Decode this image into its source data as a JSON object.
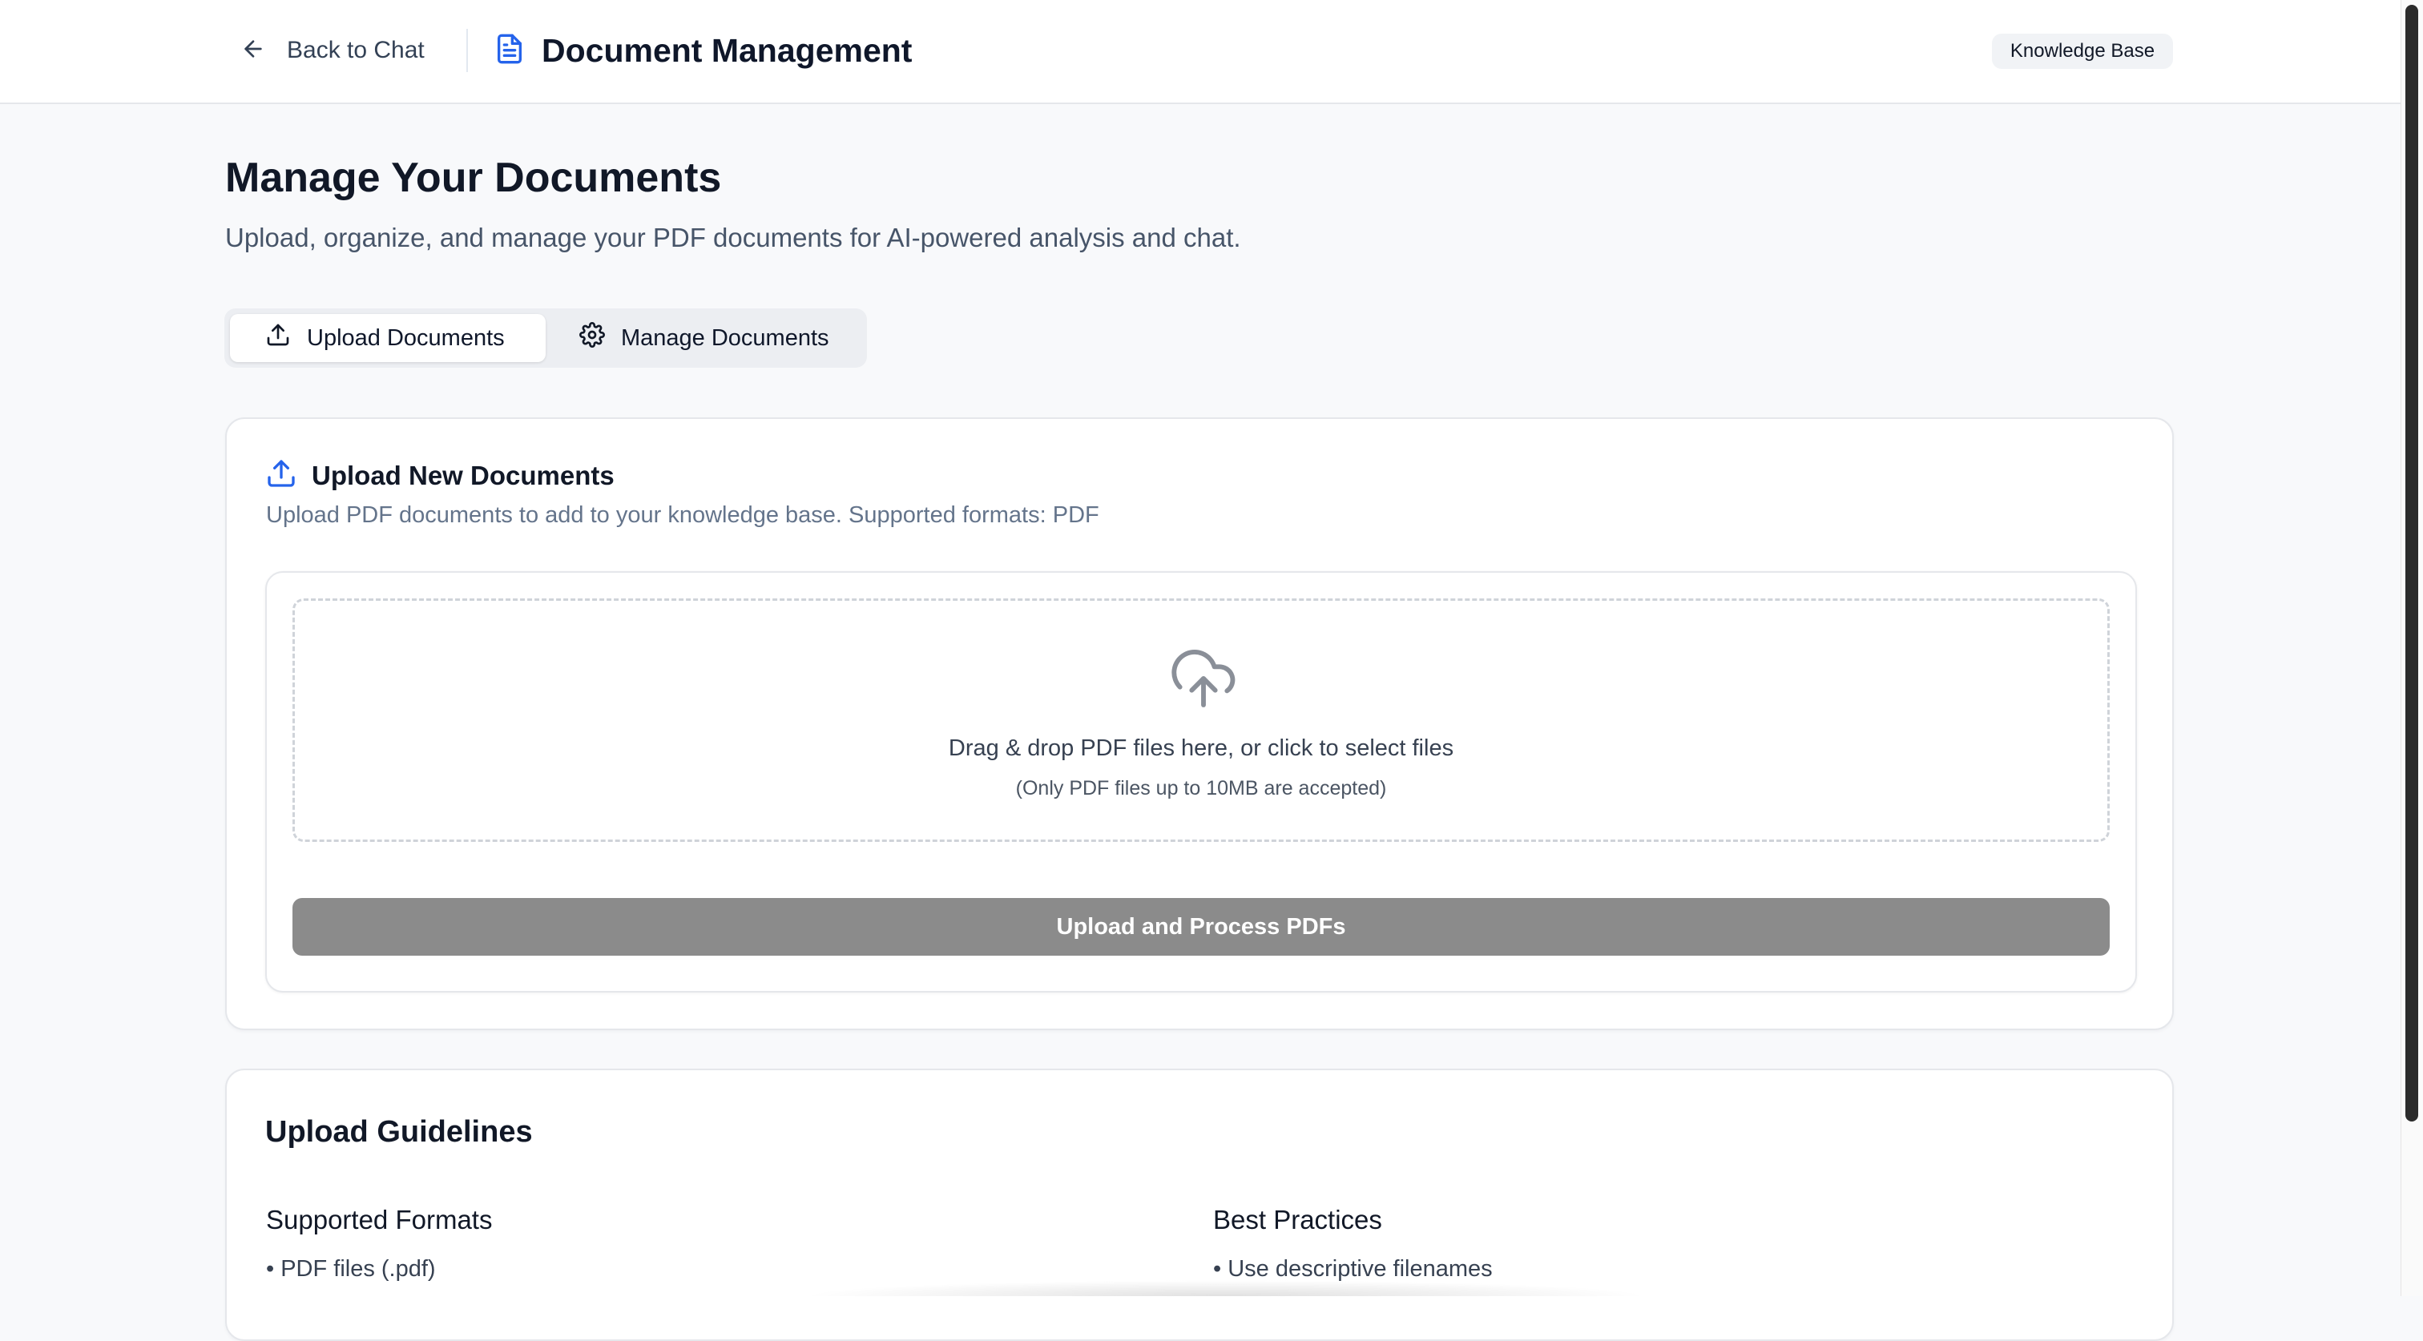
{
  "header": {
    "back_label": "Back to Chat",
    "back_icon": "arrow-left-icon",
    "title": "Document Management",
    "title_icon": "file-text-icon",
    "badge": "Knowledge Base"
  },
  "intro": {
    "title": "Manage Your Documents",
    "subtitle": "Upload, organize, and manage your PDF documents for AI-powered analysis and chat."
  },
  "tabs": [
    {
      "label": "Upload Documents",
      "icon": "upload-icon",
      "active": true
    },
    {
      "label": "Manage Documents",
      "icon": "gear-icon",
      "active": false
    }
  ],
  "upload_card": {
    "title": "Upload New Documents",
    "title_icon": "upload-icon",
    "description": "Upload PDF documents to add to your knowledge base. Supported formats: PDF",
    "dropzone": {
      "icon": "cloud-upload-icon",
      "main_text": "Drag & drop PDF files here, or click to select files",
      "note": "(Only PDF files up to 10MB are accepted)"
    },
    "button_label": "Upload and Process PDFs"
  },
  "guidelines": {
    "title": "Upload Guidelines",
    "columns": [
      {
        "title": "Supported Formats",
        "items": [
          "• PDF files (.pdf)"
        ]
      },
      {
        "title": "Best Practices",
        "items": [
          "• Use descriptive filenames"
        ]
      }
    ]
  },
  "colors": {
    "accent": "#2563eb",
    "disabled_button": "#8b8b8b",
    "page_background": "#f8f9fb"
  }
}
